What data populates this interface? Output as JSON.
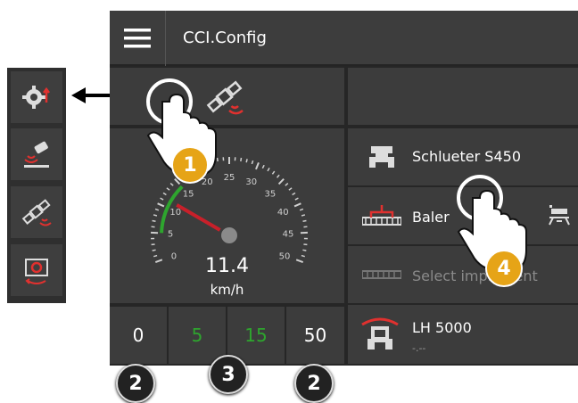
{
  "app": {
    "title": "CCI.Config"
  },
  "speedometer": {
    "value": "11.4",
    "unit": "km/h",
    "ticks": [
      "0",
      "5",
      "10",
      "15",
      "20",
      "25",
      "30",
      "35",
      "40",
      "45",
      "50"
    ],
    "green_range": [
      5,
      15
    ]
  },
  "range_buttons": [
    "0",
    "5",
    "15",
    "50"
  ],
  "implements": [
    {
      "label": "Schlueter S450",
      "sub": ""
    },
    {
      "label": "Baler",
      "sub": ""
    },
    {
      "label": "Select implement",
      "sub": ""
    },
    {
      "label": "LH 5000",
      "sub": "-.--"
    }
  ],
  "callouts": {
    "one": "1",
    "two_left": "2",
    "two_right": "2",
    "three": "3",
    "four": "4"
  },
  "colors": {
    "accent_green": "#2ea52e",
    "needle_red": "#c8202a",
    "badge_orange": "#e6a417"
  }
}
